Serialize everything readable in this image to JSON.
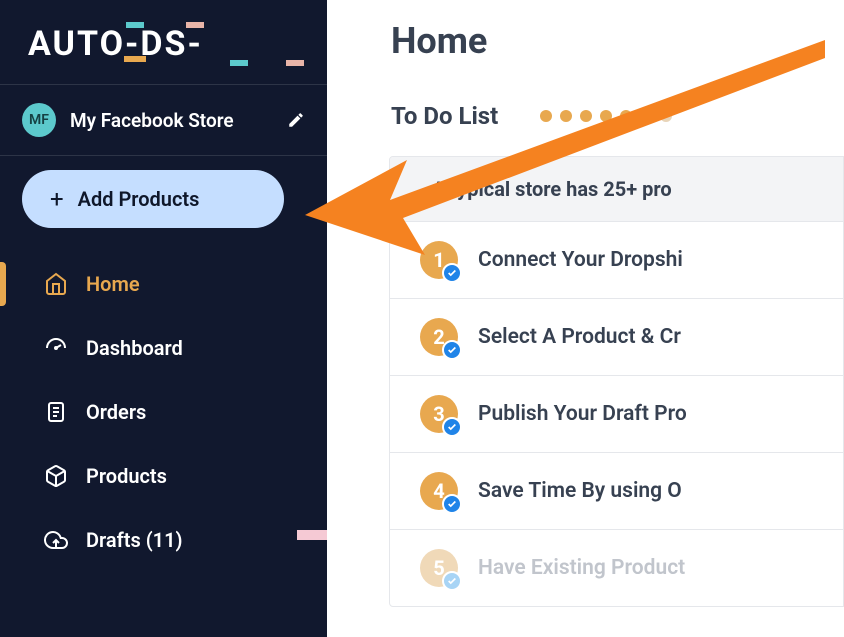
{
  "logo": {
    "text": "AUTO-DS-"
  },
  "store": {
    "initials": "MF",
    "name": "My Facebook Store"
  },
  "addProducts": {
    "label": "Add Products"
  },
  "nav": [
    {
      "label": "Home",
      "active": true
    },
    {
      "label": "Dashboard",
      "active": false
    },
    {
      "label": "Orders",
      "active": false
    },
    {
      "label": "Products",
      "active": false
    },
    {
      "label": "Drafts (11)",
      "active": false
    }
  ],
  "page": {
    "title": "Home"
  },
  "todo": {
    "title": "To Do List",
    "dots": {
      "active": 6,
      "total": 7
    },
    "banner": "A typical store has 25+ pro",
    "steps": [
      {
        "num": "1",
        "label": "Connect Your Dropshi",
        "done": true,
        "faded": false
      },
      {
        "num": "2",
        "label": "Select A Product & Cr",
        "done": true,
        "faded": false
      },
      {
        "num": "3",
        "label": "Publish Your Draft Pro",
        "done": true,
        "faded": false
      },
      {
        "num": "4",
        "label": "Save Time By using O",
        "done": true,
        "faded": false
      },
      {
        "num": "5",
        "label": "Have Existing Product",
        "done": true,
        "faded": true
      }
    ]
  }
}
